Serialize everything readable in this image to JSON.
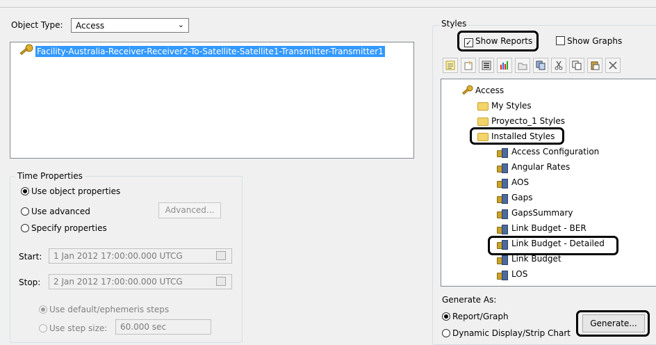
{
  "object_type": {
    "label": "Object Type:",
    "value": "Access"
  },
  "object_list": {
    "items": [
      "Facility-Australia-Receiver-Receiver2-To-Satellite-Satellite1-Transmitter-Transmitter1"
    ]
  },
  "time_properties": {
    "title": "Time Properties",
    "options": {
      "object": "Use object properties",
      "advanced": "Use advanced",
      "specify": "Specify properties"
    },
    "advanced_button": "Advanced...",
    "start_label": "Start:",
    "start_value": "1 Jan 2012 17:00:00.000 UTCG",
    "stop_label": "Stop:",
    "stop_value": "2 Jan 2012 17:00:00.000 UTCG",
    "step_default": "Use default/ephemeris steps",
    "step_size_label": "Use step size:",
    "step_size_value": "60.000 sec"
  },
  "styles": {
    "title": "Styles",
    "show_reports": "Show Reports",
    "show_graphs": "Show Graphs",
    "toolbar_icons": [
      "new-report-icon",
      "new-folder-icon",
      "properties-icon",
      "new-graph-icon",
      "open-icon",
      "duplicate-icon",
      "cut-icon",
      "copy-icon",
      "paste-icon",
      "delete-icon"
    ],
    "tree": {
      "root": "Access",
      "folders": [
        "My Styles",
        "Proyecto_1 Styles",
        "Installed Styles"
      ],
      "installed": [
        "Access Configuration",
        "Angular Rates",
        "AOS",
        "Gaps",
        "GapsSummary",
        "Link Budget - BER",
        "Link Budget - Detailed",
        "Link Budget",
        "LOS"
      ]
    },
    "generate_as": {
      "label": "Generate As:",
      "report_graph": "Report/Graph",
      "dynamic": "Dynamic Display/Strip Chart"
    },
    "generate_button": "Generate..."
  },
  "colors": {
    "selection": "#3399ff",
    "highlight": "#000000"
  }
}
